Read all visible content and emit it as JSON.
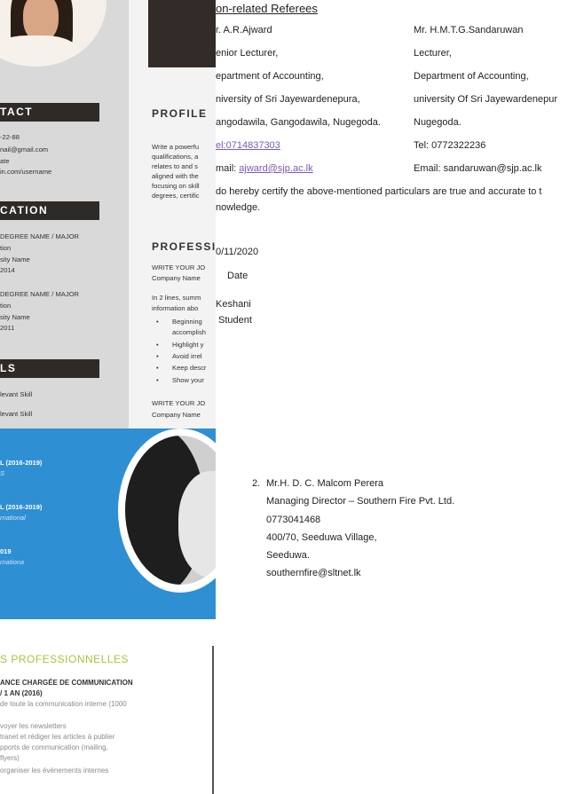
{
  "resume_left": {
    "contact_heading": "TACT",
    "contact_lines": [
      "-22-88",
      "nail@gmail.com",
      "ate",
      "in.com/username"
    ],
    "education_heading": "CATION",
    "education_lines": [
      "DEGREE NAME / MAJOR",
      "tion",
      "sity Name",
      "2014",
      "DEGREE NAME / MAJOR",
      "tion",
      "sity Name",
      "2011"
    ],
    "skills_heading": "LS",
    "skills_lines": [
      "levant Skill",
      "levant Skill"
    ],
    "profile_heading": "PROFILE",
    "profile_lines": [
      "Write a powerfu",
      "qualifications, a",
      "relates to and s",
      "aligned with the",
      "focusing on skill",
      "degrees, certific"
    ],
    "professional_heading": "PROFESSI",
    "professional_lines": [
      "WRITE YOUR JO",
      "Company Name",
      "",
      "In 2 lines, summ",
      "information abo"
    ],
    "bullets": [
      "Beginning",
      "accomplish",
      "Highlight y",
      "Avoid irrel",
      "Keep descr",
      "Show your"
    ],
    "professional_lines_2": [
      "WRITE YOUR JO",
      "Company Name"
    ]
  },
  "resume_blue": {
    "entries": [
      {
        "title": "L (2016-2019)",
        "sub": "S"
      },
      {
        "title": "L (2016-2019)",
        "sub": "rnational"
      },
      {
        "title": "019",
        "sub": "rnationa"
      }
    ]
  },
  "resume_fr": {
    "title": "S PROFESSIONNELLES",
    "job_line1": "ANCE  CHARGÉE DE COMMUNICATION",
    "job_line2": "/ 1 AN (2016)",
    "lines": [
      "de toute la communication interne (1000",
      "",
      "voyer les newsletters",
      "tranet et rédiger les articles à publier",
      "pports de communication (mailing,",
      " flyers)",
      " organiser les événements internes"
    ]
  },
  "referees": {
    "heading": "on-related Referees",
    "col1": [
      "r. A.R.Ajward",
      "enior Lecturer,",
      "epartment of Accounting,",
      "niversity of Sri Jayewardenepura,",
      "angodawila,    Gangodawila, Nugegoda."
    ],
    "col1_tel_prefix": "",
    "col1_tel_link": "el:0714837303",
    "col1_email_prefix": "mail: ",
    "col1_email_link": "ajward@sjp.ac.lk",
    "col2": [
      "Mr. H.M.T.G.Sandaruwan",
      "Lecturer,",
      "Department of Accounting,",
      "university Of Sri Jayewardenepur",
      "Nugegoda.",
      "Tel: 0772322236",
      "Email: sandaruwan@sjp.ac.lk"
    ],
    "certify_line1": "do hereby certify the above-mentioned particulars are true and accurate to t",
    "certify_line2": "nowledge.",
    "date_value": "0/11/2020",
    "date_label": "Date",
    "name_value": "Keshani",
    "name_label": "Student"
  },
  "referee2": {
    "number": "2.",
    "lines": [
      "Mr.H. D. C. Malcom Perera",
      "Managing Director  – Southern Fire Pvt. Ltd.",
      "0773041468",
      "400/70, Seeduwa Village,",
      "Seeduwa.",
      " southernfire@sltnet.lk"
    ]
  }
}
